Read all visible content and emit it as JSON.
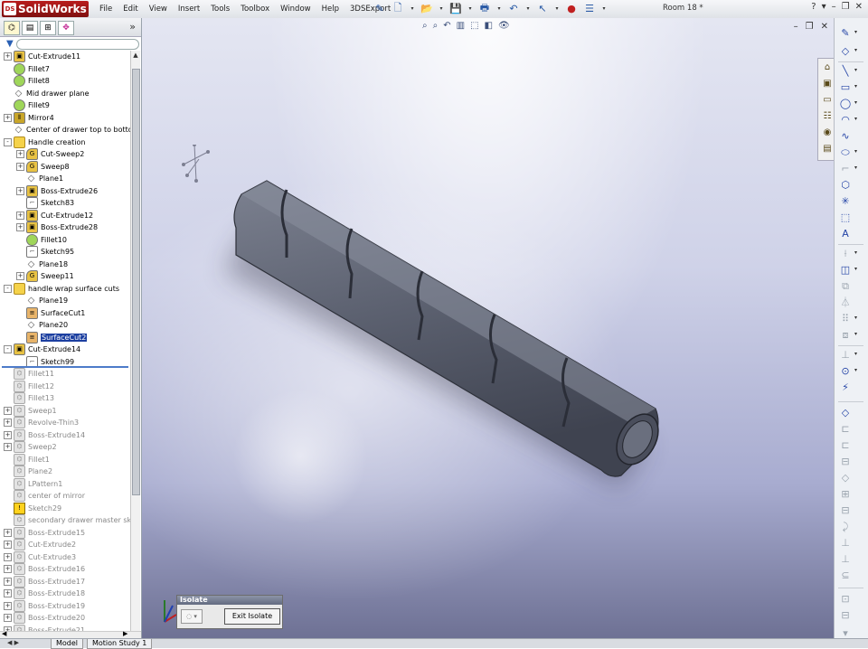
{
  "app": {
    "name": "SolidWorks",
    "logo_mark": "DS"
  },
  "menu": [
    "File",
    "Edit",
    "View",
    "Insert",
    "Tools",
    "Toolbox",
    "Window",
    "Help",
    "3DSExport"
  ],
  "document_title": "Room 18 *",
  "feature_tree": [
    {
      "label": "Cut-Extrude11",
      "icon": "extrude",
      "exp": "+",
      "indent": 0
    },
    {
      "label": "Fillet7",
      "icon": "fillet",
      "exp": "",
      "indent": 0
    },
    {
      "label": "Fillet8",
      "icon": "fillet",
      "exp": "",
      "indent": 0
    },
    {
      "label": "Mid drawer plane",
      "icon": "plane",
      "exp": "",
      "indent": 0
    },
    {
      "label": "Fillet9",
      "icon": "fillet",
      "exp": "",
      "indent": 0
    },
    {
      "label": "Mirror4",
      "icon": "mirror",
      "exp": "+",
      "indent": 0
    },
    {
      "label": "Center of drawer top to botton",
      "icon": "plane",
      "exp": "",
      "indent": 0
    },
    {
      "label": "Handle creation",
      "icon": "folder",
      "exp": "-",
      "indent": 0
    },
    {
      "label": "Cut-Sweep2",
      "icon": "sweep",
      "exp": "+",
      "indent": 1
    },
    {
      "label": "Sweep8",
      "icon": "sweep",
      "exp": "+",
      "indent": 1
    },
    {
      "label": "Plane1",
      "icon": "plane",
      "exp": "",
      "indent": 1
    },
    {
      "label": "Boss-Extrude26",
      "icon": "extrude",
      "exp": "+",
      "indent": 1
    },
    {
      "label": "Sketch83",
      "icon": "sketch",
      "exp": "",
      "indent": 1
    },
    {
      "label": "Cut-Extrude12",
      "icon": "extrude",
      "exp": "+",
      "indent": 1
    },
    {
      "label": "Boss-Extrude28",
      "icon": "extrude",
      "exp": "+",
      "indent": 1
    },
    {
      "label": "Fillet10",
      "icon": "fillet",
      "exp": "",
      "indent": 1
    },
    {
      "label": "Sketch95",
      "icon": "sketch",
      "exp": "",
      "indent": 1
    },
    {
      "label": "Plane18",
      "icon": "plane",
      "exp": "",
      "indent": 1
    },
    {
      "label": "Sweep11",
      "icon": "sweep",
      "exp": "+",
      "indent": 1
    },
    {
      "label": "handle wrap surface cuts",
      "icon": "folder",
      "exp": "-",
      "indent": 0
    },
    {
      "label": "Plane19",
      "icon": "plane",
      "exp": "",
      "indent": 1
    },
    {
      "label": "SurfaceCut1",
      "icon": "surf",
      "exp": "",
      "indent": 1
    },
    {
      "label": "Plane20",
      "icon": "plane",
      "exp": "",
      "indent": 1
    },
    {
      "label": "SurfaceCut2",
      "icon": "surf",
      "exp": "",
      "indent": 1,
      "selected": true
    },
    {
      "label": "Cut-Extrude14",
      "icon": "extrude",
      "exp": "-",
      "indent": 0
    },
    {
      "label": "Sketch99",
      "icon": "sketch",
      "exp": "",
      "indent": 1
    },
    {
      "label": "Fillet11",
      "icon": "grey",
      "exp": "",
      "indent": 0,
      "suppressed": true
    },
    {
      "label": "Fillet12",
      "icon": "grey",
      "exp": "",
      "indent": 0,
      "suppressed": true
    },
    {
      "label": "Fillet13",
      "icon": "grey",
      "exp": "",
      "indent": 0,
      "suppressed": true
    },
    {
      "label": "Sweep1",
      "icon": "grey",
      "exp": "+",
      "indent": 0,
      "suppressed": true
    },
    {
      "label": "Revolve-Thin3",
      "icon": "grey",
      "exp": "+",
      "indent": 0,
      "suppressed": true
    },
    {
      "label": "Boss-Extrude14",
      "icon": "grey",
      "exp": "+",
      "indent": 0,
      "suppressed": true
    },
    {
      "label": "Sweep2",
      "icon": "grey",
      "exp": "+",
      "indent": 0,
      "suppressed": true
    },
    {
      "label": "Fillet1",
      "icon": "grey",
      "exp": "",
      "indent": 0,
      "suppressed": true
    },
    {
      "label": "Plane2",
      "icon": "grey",
      "exp": "",
      "indent": 0,
      "suppressed": true
    },
    {
      "label": "LPattern1",
      "icon": "grey",
      "exp": "",
      "indent": 0,
      "suppressed": true
    },
    {
      "label": "center of mirror",
      "icon": "grey",
      "exp": "",
      "indent": 0,
      "suppressed": true
    },
    {
      "label": "Sketch29",
      "icon": "warn",
      "exp": "",
      "indent": 0,
      "suppressed": true
    },
    {
      "label": "secondary drawer master sketc",
      "icon": "grey",
      "exp": "",
      "indent": 0,
      "suppressed": true
    },
    {
      "label": "Boss-Extrude15",
      "icon": "grey",
      "exp": "+",
      "indent": 0,
      "suppressed": true
    },
    {
      "label": "Cut-Extrude2",
      "icon": "grey",
      "exp": "+",
      "indent": 0,
      "suppressed": true
    },
    {
      "label": "Cut-Extrude3",
      "icon": "grey",
      "exp": "+",
      "indent": 0,
      "suppressed": true
    },
    {
      "label": "Boss-Extrude16",
      "icon": "grey",
      "exp": "+",
      "indent": 0,
      "suppressed": true
    },
    {
      "label": "Boss-Extrude17",
      "icon": "grey",
      "exp": "+",
      "indent": 0,
      "suppressed": true
    },
    {
      "label": "Boss-Extrude18",
      "icon": "grey",
      "exp": "+",
      "indent": 0,
      "suppressed": true
    },
    {
      "label": "Boss-Extrude19",
      "icon": "grey",
      "exp": "+",
      "indent": 0,
      "suppressed": true
    },
    {
      "label": "Boss-Extrude20",
      "icon": "grey",
      "exp": "+",
      "indent": 0,
      "suppressed": true
    },
    {
      "label": "Boss-Extrude21",
      "icon": "grey",
      "exp": "+",
      "indent": 0,
      "suppressed": true
    }
  ],
  "isolate": {
    "title": "Isolate",
    "exit_label": "Exit Isolate"
  },
  "bottom_tabs": [
    "Model",
    "Motion Study 1"
  ],
  "colors": {
    "accent": "#1c3fa0",
    "title_bar": "#b91c1c",
    "model": "#5c6170"
  }
}
